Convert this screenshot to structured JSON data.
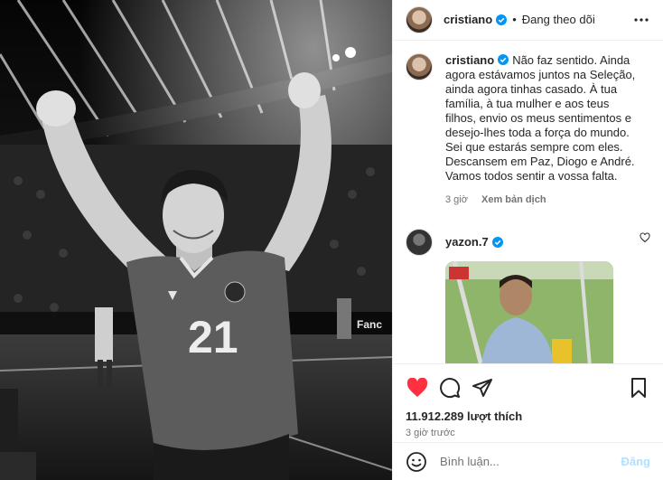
{
  "header": {
    "username": "cristiano",
    "separator": "•",
    "follow_status": "Đang theo dõi"
  },
  "caption": {
    "username": "cristiano",
    "text": "Não faz sentido. Ainda agora estávamos juntos na Seleção, ainda agora tinhas casado. À tua família, à tua mulher e aos teus filhos, envio os meus sentimentos e desejo-lhes toda a força do mundo. Sei que estarás sempre com eles. Descansem em Paz, Diogo e André. Vamos todos sentir a vossa falta.",
    "time": "3 giờ",
    "translate": "Xem bản dịch"
  },
  "reply": {
    "username": "yazon.7"
  },
  "photo": {
    "jersey_number": "21"
  },
  "actions": {
    "likes": "11.912.289 lượt thích",
    "time": "3 giờ trước"
  },
  "composer": {
    "placeholder": "Bình luận...",
    "post_label": "Đăng"
  },
  "colors": {
    "like_red": "#ff3040",
    "verified_blue": "#0095f6",
    "post_disabled": "#b2dffc"
  }
}
